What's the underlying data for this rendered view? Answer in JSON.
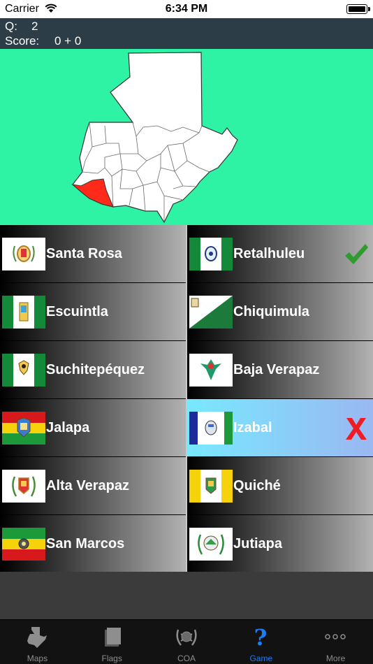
{
  "status_bar": {
    "carrier": "Carrier",
    "time": "6:34 PM"
  },
  "score_panel": {
    "question_label": "Q:",
    "question_value": "2",
    "score_label": "Score:",
    "score_value": "0 + 0"
  },
  "map": {
    "background_color": "#2ef2a4",
    "highlight_color": "#ff2a1a"
  },
  "answers": [
    {
      "label": "Santa Rosa",
      "flag_icon": "santa-rosa-flag-icon"
    },
    {
      "label": "Retalhuleu",
      "flag_icon": "retalhuleu-flag-icon",
      "status": "correct",
      "mark_icon": "checkmark-icon"
    },
    {
      "label": "Escuintla",
      "flag_icon": "escuintla-flag-icon"
    },
    {
      "label": "Chiquimula",
      "flag_icon": "chiquimula-flag-icon"
    },
    {
      "label": "Suchitepéquez",
      "flag_icon": "suchitepequez-flag-icon"
    },
    {
      "label": "Baja Verapaz",
      "flag_icon": "baja-verapaz-flag-icon"
    },
    {
      "label": "Jalapa",
      "flag_icon": "jalapa-flag-icon"
    },
    {
      "label": "Izabal",
      "flag_icon": "izabal-flag-icon",
      "status": "wrong",
      "mark_icon": "x-mark-icon"
    },
    {
      "label": "Alta Verapaz",
      "flag_icon": "alta-verapaz-flag-icon"
    },
    {
      "label": "Quiché",
      "flag_icon": "quiche-flag-icon"
    },
    {
      "label": "San Marcos",
      "flag_icon": "san-marcos-flag-icon"
    },
    {
      "label": "Jutiapa",
      "flag_icon": "jutiapa-flag-icon"
    }
  ],
  "colors": {
    "correct": "#2e9c2e",
    "wrong": "#ee1c24",
    "tab_active": "#1e7cf5",
    "tab_inactive": "#8e8e8e"
  },
  "tab_bar": {
    "active": "Game",
    "tabs": [
      {
        "label": "Maps",
        "icon": "map-icon"
      },
      {
        "label": "Flags",
        "icon": "flags-icon"
      },
      {
        "label": "COA",
        "icon": "coat-of-arms-icon"
      },
      {
        "label": "Game",
        "icon": "question-mark-icon"
      },
      {
        "label": "More",
        "icon": "more-dots-icon"
      }
    ]
  }
}
